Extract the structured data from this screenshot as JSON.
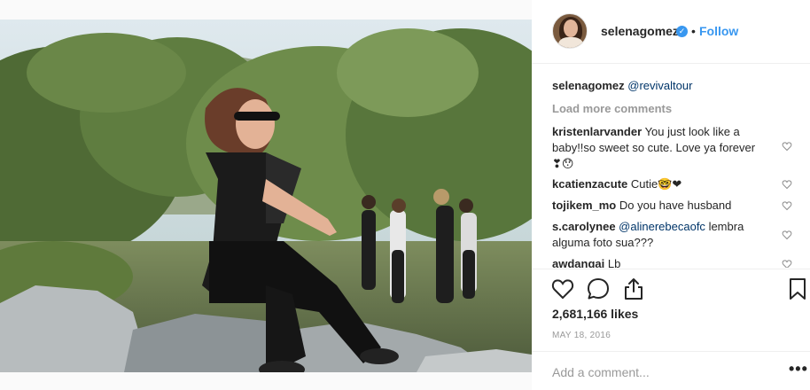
{
  "post": {
    "author": "selenagomez",
    "follow_label": "Follow",
    "separator": "•",
    "caption_user": "selenagomez",
    "caption_text": "@revivaltour",
    "load_more_label": "Load more comments",
    "likes": "2,681,166 likes",
    "date": "MAY 18, 2016",
    "add_comment_placeholder": "Add a comment...",
    "more_label": "•••"
  },
  "comments": [
    {
      "user": "kristenlarvander",
      "text": "You just look like a",
      "line2": "baby!!so sweet so cute. Love ya forever",
      "line3": "❣😯"
    },
    {
      "user": "kcatienzacute",
      "text": "Cutie🤓❤"
    },
    {
      "user": "tojikem_mo",
      "text": "Do you have husband"
    },
    {
      "user": "s.carolynee",
      "mention": "@alinerebecaofc",
      "text": "lembra",
      "line2": "alguma foto sua???"
    },
    {
      "user": "awdangai",
      "text": "Lb"
    }
  ],
  "icons": {
    "verified": "verified-badge-icon",
    "like": "heart-icon",
    "comment": "comment-bubble-icon",
    "share": "share-icon",
    "save": "bookmark-icon",
    "comment_like": "heart-outline-icon",
    "options": "more-options-icon"
  },
  "colors": {
    "link": "#3897f0",
    "mention": "#003569",
    "muted": "#999999",
    "text": "#262626",
    "border": "#efefef"
  }
}
